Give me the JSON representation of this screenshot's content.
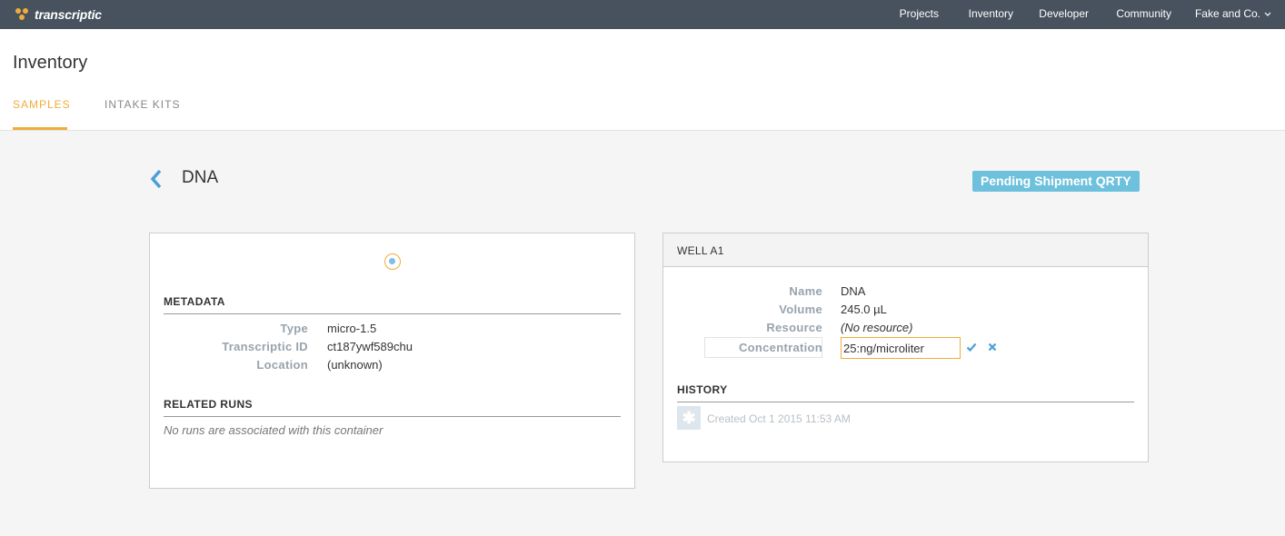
{
  "topbar": {
    "logo_text": "transcriptic",
    "nav": [
      {
        "label": "Projects"
      },
      {
        "label": "Inventory"
      },
      {
        "label": "Developer"
      },
      {
        "label": "Community"
      },
      {
        "label": "Fake and Co."
      }
    ],
    "org_chevron_icon": "chevron-down-icon"
  },
  "header": {
    "title": "Inventory",
    "tabs": [
      {
        "label": "SAMPLES",
        "active": true
      },
      {
        "label": "INTAKE KITS",
        "active": false
      }
    ]
  },
  "container": {
    "back_icon": "chevron-left-icon",
    "title": "DNA",
    "status": "Pending Shipment QRTY"
  },
  "left_panel": {
    "metadata_heading": "METADATA",
    "metadata": [
      {
        "label": "Type",
        "value": "micro-1.5"
      },
      {
        "label": "Transcriptic ID",
        "value": "ct187ywf589chu"
      },
      {
        "label": "Location",
        "value": "(unknown)"
      }
    ],
    "related_runs_heading": "RELATED RUNS",
    "related_runs_empty": "No runs are associated with this container"
  },
  "right_panel": {
    "title": "WELL A1",
    "fields": [
      {
        "label": "Name",
        "value": "DNA"
      },
      {
        "label": "Volume",
        "value": "245.0 µL"
      },
      {
        "label": "Resource",
        "value": "(No resource)"
      }
    ],
    "concentration": {
      "label": "Concentration",
      "value": "25:ng/microliter"
    },
    "confirm_icon": "check-icon",
    "cancel_icon": "close-icon",
    "history_heading": "HISTORY",
    "history": [
      {
        "icon": "asterisk-icon",
        "text": "Created Oct 1 2015 11:53 AM"
      }
    ]
  },
  "colors": {
    "topbar": "#48525e",
    "accent": "#f0ac3a",
    "badge": "#6ec1dc",
    "link": "#4a9fd8"
  }
}
